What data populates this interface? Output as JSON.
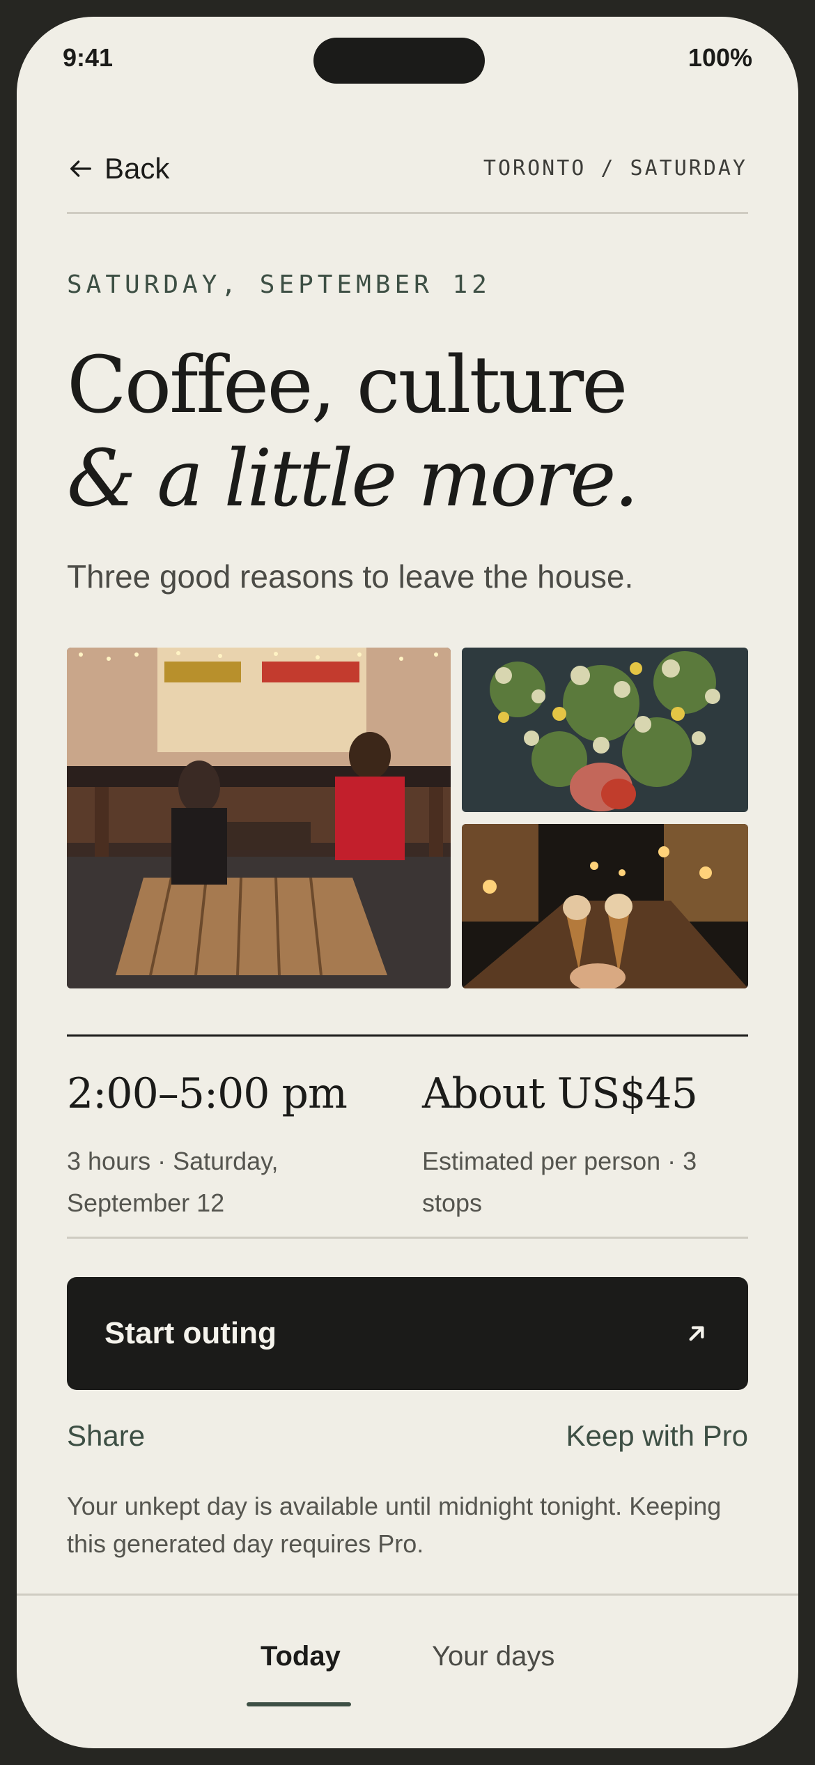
{
  "status": {
    "time": "9:41",
    "battery": "100%"
  },
  "header": {
    "back_label": "Back",
    "breadcrumb": "TORONTO / SATURDAY"
  },
  "outing": {
    "date": "SATURDAY, SEPTEMBER 12",
    "title_line1": "Coffee, culture",
    "title_line2": "& a little more.",
    "subtitle": "Three good reasons to leave the house.",
    "photos": [
      {
        "subject": "cafe-patio"
      },
      {
        "subject": "floral-painting"
      },
      {
        "subject": "ice-cream-street"
      }
    ],
    "time": {
      "heading": "2:00–5:00 pm",
      "detail": "3 hours · Saturday, September 12"
    },
    "cost": {
      "heading": "About US$45",
      "detail": "Estimated per person · 3 stops"
    }
  },
  "actions": {
    "start_label": "Start outing",
    "share_label": "Share",
    "keep_label": "Keep with Pro",
    "note": "Your unkept day is available until midnight tonight. Keeping this generated day requires Pro."
  },
  "tabs": [
    {
      "label": "Today",
      "selected": true
    },
    {
      "label": "Your days",
      "selected": false
    }
  ],
  "colors": {
    "background": "#f0eee6",
    "ink": "#1b1b19",
    "accent": "#3d4f44"
  }
}
